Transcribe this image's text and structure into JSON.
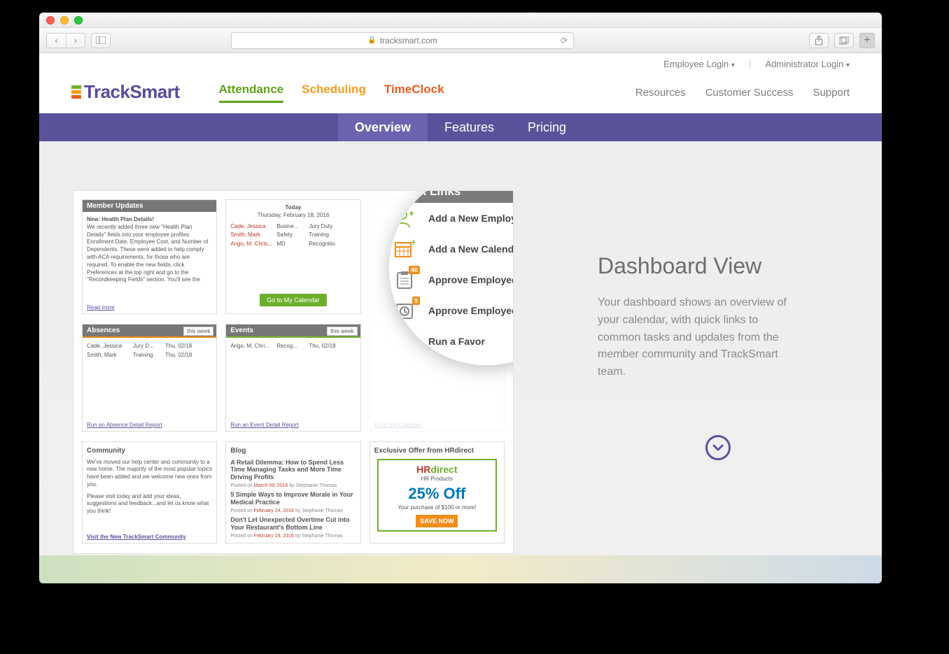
{
  "browser": {
    "url": "tracksmart.com"
  },
  "top_links": {
    "employee": "Employee Login",
    "admin": "Administrator Login"
  },
  "bottom_links": {
    "resources": "Resources",
    "success": "Customer Success",
    "support": "Support"
  },
  "brand_text": "TrackSmart",
  "product_tabs": {
    "attendance": "Attendance",
    "scheduling": "Scheduling",
    "timeclock": "TimeClock"
  },
  "subnav": {
    "overview": "Overview",
    "features": "Features",
    "pricing": "Pricing"
  },
  "hero": {
    "title": "Dashboard View",
    "body": "Your dashboard shows an overview of your calendar, with quick links to common tasks and updates from the member community and TrackSmart team."
  },
  "dashboard": {
    "member_updates": {
      "header": "Member Updates",
      "title": "New: Health Plan Details!",
      "body": "We recently added three new \"Health Plan Details\" fields into your employee profiles: Enrollment Date, Employee Cost, and Number of Dependents. These were added to help comply with ACA requirements, for those who are required.  To enable the new fields, click Preferences at the top right and go to the \"Recordkeeping Fields\" section. You'll see the",
      "link": "Read more"
    },
    "today": {
      "label": "Today",
      "date": "Thursday, February 18, 2016",
      "rows": [
        {
          "name": "Cade, Jessica",
          "type": "Busine...",
          "reason": "Jury Duty"
        },
        {
          "name": "Smith, Mark",
          "type": "Safety",
          "reason": "Training"
        },
        {
          "name": "Arigo, M. Chris...",
          "type": "MD",
          "reason": "Recognitio"
        }
      ],
      "button": "Go to My Calendar"
    },
    "absences": {
      "header": "Absences",
      "filter": "this week",
      "rows": [
        {
          "name": "Cade, Jessica",
          "type": "Jury D...",
          "date": "Thu, 02/18"
        },
        {
          "name": "Smith, Mark",
          "type": "Training",
          "date": "Thu, 02/18"
        }
      ],
      "link": "Run an Absence Detail Report"
    },
    "events": {
      "header": "Events",
      "filter": "this week",
      "rows": [
        {
          "name": "Arigo, M. Chri...",
          "type": "Recog...",
          "date": "Thu, 02/18"
        }
      ],
      "link": "Run an Event Detail Report"
    },
    "cal_link": "Go to my Calendar",
    "community": {
      "header": "Community",
      "p1": "We've moved our help center and community to a new home. The majority of the most popular topics have been added and we welcome new ones from you.",
      "p2": "Please visit today and add your ideas, suggestions and feedback...and let us know what you think!",
      "link": "Visit the New TrackSmart Community"
    },
    "blog": {
      "header": "Blog",
      "posts": [
        {
          "title": "A Retail Dilemma: How to Spend Less Time Managing Tasks and More Time Driving Profits",
          "date": "March 09, 2016",
          "by": "Stephanie Thomas"
        },
        {
          "title": "5 Simple Ways to Improve Morale in Your Medical Practice",
          "date": "February 24, 2016",
          "by": "Stephanie Thomas"
        },
        {
          "title": "Don't Let Unexpected Overtime Cut into Your Restaurant's Bottom Line",
          "date": "February 19, 2016",
          "by": "Stephanie Thomas"
        }
      ]
    },
    "offer": {
      "header": "Exclusive Offer from HRdirect",
      "logo1": "HR",
      "logo2": "direct",
      "hp": "HR Products",
      "big": "25% Off",
      "sub": "Your purchase of $100 or more!",
      "save": "SAVE NOW"
    }
  },
  "quicklinks": {
    "header": "Quick Links",
    "items": [
      {
        "label": "Add a New Employee",
        "icon": "user-plus",
        "badge": ""
      },
      {
        "label": "Add a New Calendar Ev",
        "icon": "calendar-plus",
        "badge": ""
      },
      {
        "label": "Approve Employee Tim",
        "icon": "clipboard",
        "badge": "40"
      },
      {
        "label": "Approve Employee",
        "icon": "clock",
        "badge": "9"
      },
      {
        "label": "Run a Favor",
        "icon": "star",
        "badge": ""
      }
    ]
  }
}
